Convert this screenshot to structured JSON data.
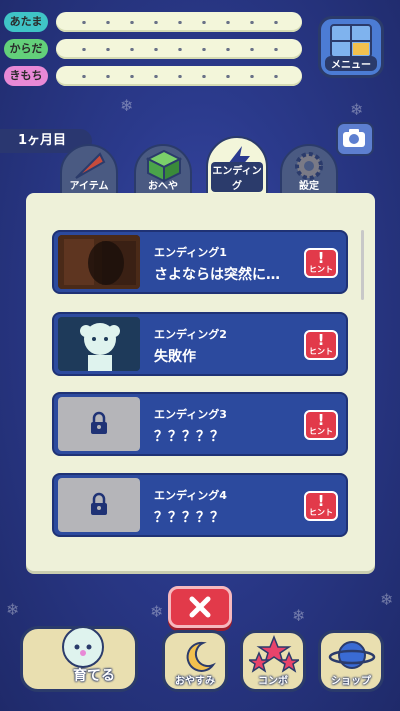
{
  "stats": [
    {
      "label": "あたま",
      "color": "#3fc4c6"
    },
    {
      "label": "からだ",
      "color": "#63d07a"
    },
    {
      "label": "きもち",
      "color": "#e889d6"
    }
  ],
  "menu": {
    "label": "メニュー"
  },
  "month": "1ヶ月目",
  "tabs": [
    {
      "label": "アイテム",
      "icon": "cone-icon"
    },
    {
      "label": "おへや",
      "icon": "cube-icon"
    },
    {
      "label": "エンディング",
      "icon": "lightning-icon"
    },
    {
      "label": "設定",
      "icon": "gear-icon"
    }
  ],
  "endings": [
    {
      "number": "エンディング1",
      "title": "さよならは突然に…",
      "hint": "ヒント",
      "locked": false
    },
    {
      "number": "エンディング2",
      "title": "失敗作",
      "hint": "ヒント",
      "locked": false
    },
    {
      "number": "エンディング3",
      "title": "？？？？？",
      "hint": "ヒント",
      "locked": true
    },
    {
      "number": "エンディング4",
      "title": "？？？？？",
      "hint": "ヒント",
      "locked": true
    }
  ],
  "nav": {
    "raise": "育てる",
    "sleep": "おやすみ",
    "combo": "コンボ",
    "shop": "ショップ"
  },
  "colors": {
    "accent": "#e23a4a",
    "card": "#2c4a9e",
    "panel": "#eef1d9"
  }
}
